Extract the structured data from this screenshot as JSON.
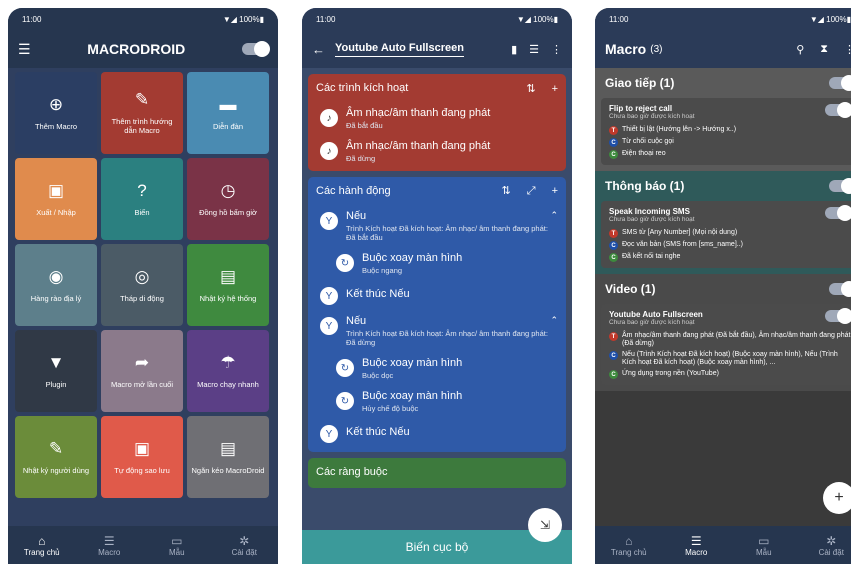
{
  "status": {
    "time": "11:00",
    "signal": "▼◢ 100%▮"
  },
  "p1": {
    "title": "MACRODROID",
    "tiles": [
      {
        "label": "Thêm Macro",
        "icon": "⊕",
        "color": "#2b3e63"
      },
      {
        "label": "Thêm trình hướng dẫn Macro",
        "icon": "✎",
        "color": "#a33b32"
      },
      {
        "label": "Diễn đàn",
        "icon": "▬",
        "color": "#4a8bb2"
      },
      {
        "label": "Xuất / Nhập",
        "icon": "▣",
        "color": "#e08b4d"
      },
      {
        "label": "Biến",
        "icon": "?",
        "color": "#2b8080"
      },
      {
        "label": "Đồng hồ bấm giờ",
        "icon": "◷",
        "color": "#7a3347"
      },
      {
        "label": "Hàng rào địa lý",
        "icon": "◉",
        "color": "#5d7f8b"
      },
      {
        "label": "Tháp di động",
        "icon": "◎",
        "color": "#4b5b66"
      },
      {
        "label": "Nhật ký hệ thống",
        "icon": "▤",
        "color": "#3f8a3f"
      },
      {
        "label": "Plugin",
        "icon": "▼",
        "color": "#303946"
      },
      {
        "label": "Macro mở lần cuối",
        "icon": "➦",
        "color": "#8b7a8b"
      },
      {
        "label": "Macro chạy nhanh",
        "icon": "☂",
        "color": "#5b3f86"
      },
      {
        "label": "Nhật ký người dùng",
        "icon": "✎",
        "color": "#6b8c3a"
      },
      {
        "label": "Tự động sao lưu",
        "icon": "▣",
        "color": "#e05a4a"
      },
      {
        "label": "Ngăn kéo MacroDroid",
        "icon": "▤",
        "color": "#6f6f74"
      }
    ],
    "nav": [
      {
        "label": "Trang chủ",
        "icon": "⌂"
      },
      {
        "label": "Macro",
        "icon": "☰"
      },
      {
        "label": "Mẫu",
        "icon": "▭"
      },
      {
        "label": "Cài đặt",
        "icon": "✲"
      }
    ]
  },
  "p2": {
    "title": "Youtube Auto Fullscreen",
    "triggers_title": "Các trình kích hoạt",
    "triggers": [
      {
        "t1": "Âm nhạc/âm thanh đang phát",
        "t2": "Đã bắt đầu"
      },
      {
        "t1": "Âm nhạc/âm thanh đang phát",
        "t2": "Đã dừng"
      }
    ],
    "actions_title": "Các hành động",
    "if1": {
      "t1": "Nếu",
      "t2": "Trình Kích hoạt Đã kích hoạt: Âm nhạc/ âm thanh đang phát: Đã bắt đầu"
    },
    "a1": {
      "t1": "Buộc xoay màn hình",
      "t2": "Buộc ngang"
    },
    "end1": "Kết thúc Nếu",
    "if2": {
      "t1": "Nếu",
      "t2": "Trình Kích hoạt Đã kích hoạt: Âm nhạc/ âm thanh đang phát: Đã dừng"
    },
    "a2": {
      "t1": "Buộc xoay màn hình",
      "t2": "Buộc dọc"
    },
    "a3": {
      "t1": "Buộc xoay màn hình",
      "t2": "Hủy chế độ buộc"
    },
    "end2": "Kết thúc Nếu",
    "constraints_title": "Các ràng buộc",
    "bottom": "Biến cục bộ"
  },
  "p3": {
    "title": "Macro",
    "count": "(3)",
    "groups": [
      {
        "name": "Giao tiếp (1)",
        "color": "#5a5a5a",
        "macro": {
          "title": "Flip to reject call",
          "sub": "Chưa bao giờ được kích hoạt",
          "lines": [
            {
              "b": "T",
              "text": "Thiết bị lật (Hướng lên -> Hướng x..)"
            },
            {
              "b": "C",
              "text": "Từ chối cuộc gọi"
            },
            {
              "b": "C",
              "text": "Điện thoại reo"
            }
          ]
        }
      },
      {
        "name": "Thông báo (1)",
        "color": "#2f5a5a",
        "macro": {
          "title": "Speak Incoming SMS",
          "sub": "Chưa bao giờ được kích hoạt",
          "lines": [
            {
              "b": "T",
              "text": "SMS từ [Any Number] (Mọi nội dung)"
            },
            {
              "b": "C",
              "text": "Đọc văn bản (SMS from [sms_name]..)"
            },
            {
              "b": "C",
              "text": "Đã kết nối tai nghe"
            }
          ]
        }
      },
      {
        "name": "Video (1)",
        "color": "#4a4a4a",
        "macro": {
          "title": "Youtube Auto Fullscreen",
          "sub": "Chưa bao giờ được kích hoạt",
          "lines": [
            {
              "b": "T",
              "text": "Âm nhạc/âm thanh đang phát (Đã bắt đầu), Âm nhạc/âm thanh đang phát (Đã dừng)"
            },
            {
              "b": "C",
              "text": "Nếu (Trình Kích hoạt Đã kích hoạt) (Buộc xoay màn hình), Nếu (Trình Kích hoạt Đã kích hoạt) (Buộc xoay màn hình), ..."
            },
            {
              "b": "C",
              "text": "Ứng dụng trong nền (YouTube)"
            }
          ]
        }
      }
    ],
    "nav": [
      {
        "label": "Trang chủ",
        "icon": "⌂"
      },
      {
        "label": "Macro",
        "icon": "☰"
      },
      {
        "label": "Mẫu",
        "icon": "▭"
      },
      {
        "label": "Cài đặt",
        "icon": "✲"
      }
    ]
  }
}
